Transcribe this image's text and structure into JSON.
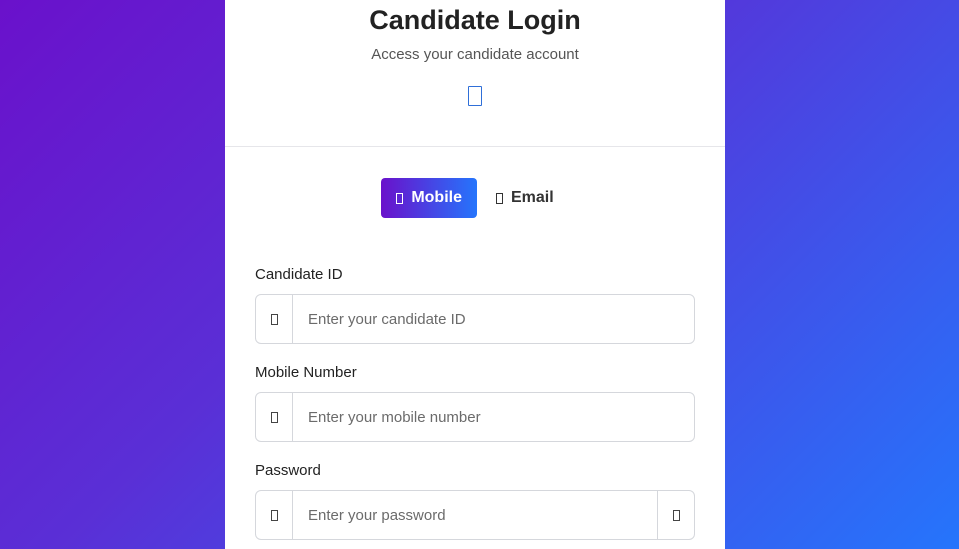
{
  "header": {
    "title": "Candidate Login",
    "subtitle": "Access your candidate account",
    "icon": "mobile-phone-icon"
  },
  "login_method": {
    "options": [
      {
        "label": "Mobile",
        "icon": "mobile-icon",
        "active": true
      },
      {
        "label": "Email",
        "icon": "envelope-icon",
        "active": false
      }
    ]
  },
  "form": {
    "candidate_id": {
      "label": "Candidate ID",
      "placeholder": "Enter your candidate ID",
      "value": "",
      "icon": "id-card-icon"
    },
    "mobile": {
      "label": "Mobile Number",
      "placeholder": "Enter your mobile number",
      "value": "",
      "icon": "phone-icon"
    },
    "password": {
      "label": "Password",
      "placeholder": "Enter your password",
      "value": "",
      "icon": "lock-icon",
      "toggle_icon": "eye-icon"
    }
  },
  "colors": {
    "background_start": "#6a11cb",
    "background_end": "#2575fc",
    "accent": "#2f6fd8"
  }
}
